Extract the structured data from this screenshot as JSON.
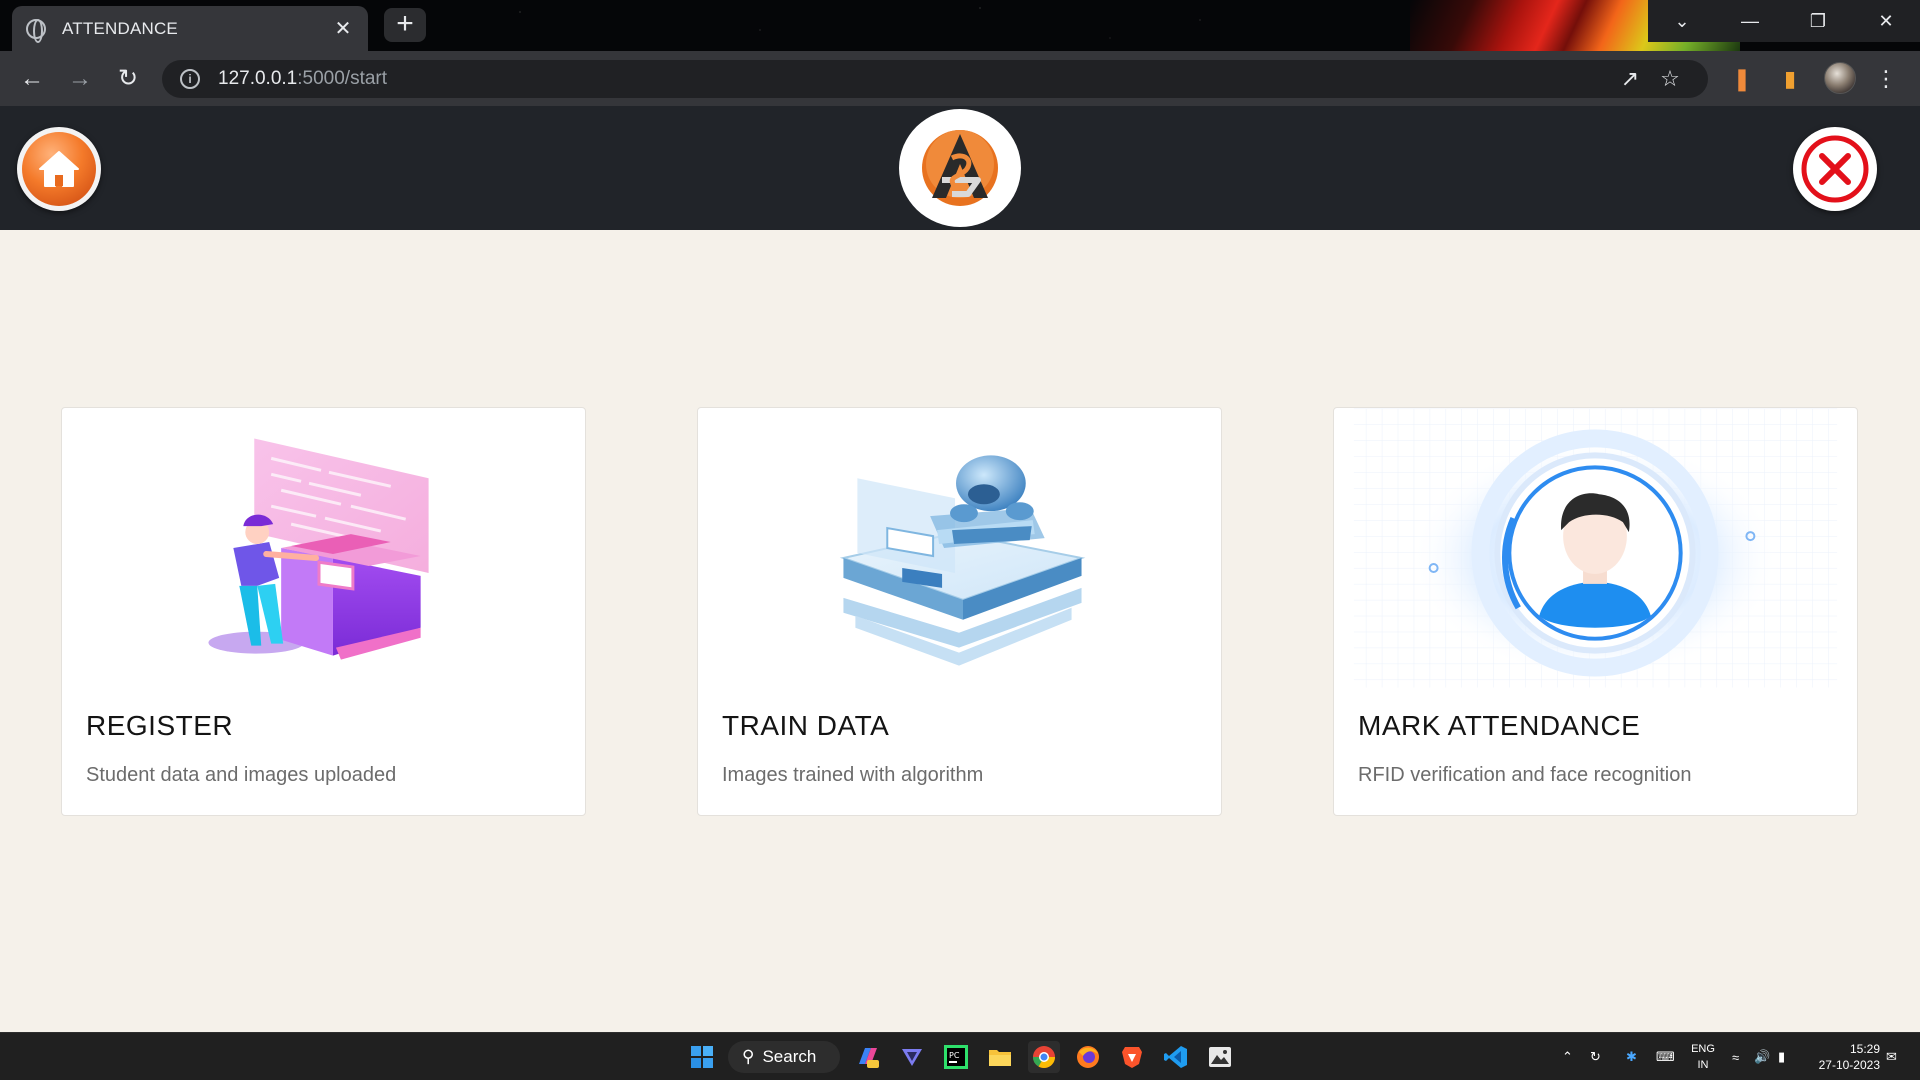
{
  "browser": {
    "tab_title": "ATTENDANCE",
    "new_tab_label": "+",
    "url_host": "127.0.0.1",
    "url_rest": ":5000/start"
  },
  "app": {
    "home_label": "home",
    "close_label": "close"
  },
  "cards": [
    {
      "title": "REGISTER",
      "description": "Student data and images uploaded"
    },
    {
      "title": "TRAIN DATA",
      "description": "Images trained with algorithm"
    },
    {
      "title": "MARK ATTENDANCE",
      "description": "RFID verification and face recognition"
    }
  ],
  "taskbar": {
    "search_label": "Search",
    "lang_line1": "ENG",
    "lang_line2": "IN",
    "time": "15:29",
    "date": "27-10-2023"
  },
  "colors": {
    "header_bg": "#212429",
    "page_bg": "#f5f1ea",
    "accent_orange": "#f47a2a",
    "close_red": "#e3101a"
  }
}
